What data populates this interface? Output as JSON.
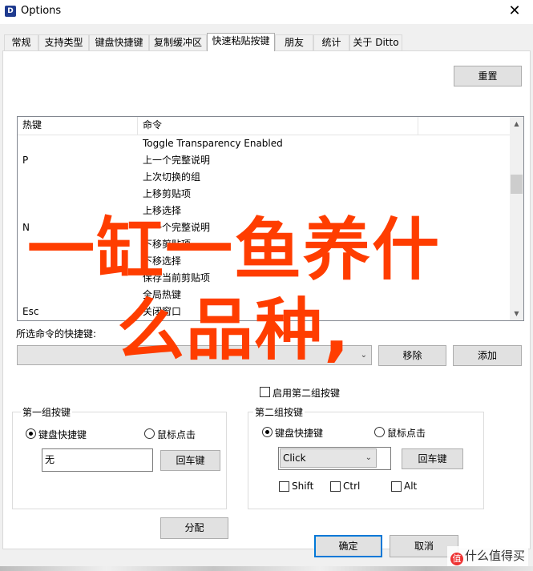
{
  "window": {
    "title": "Options",
    "app_icon": "ditto-icon",
    "close_glyph": "✕"
  },
  "tabs": [
    {
      "label": "常规"
    },
    {
      "label": "支持类型"
    },
    {
      "label": "键盘快捷键"
    },
    {
      "label": "复制缓冲区"
    },
    {
      "label": "快速粘贴按键",
      "active": true
    },
    {
      "label": "朋友"
    },
    {
      "label": "统计"
    },
    {
      "label": "关于 Ditto"
    }
  ],
  "panel": {
    "reset_label": "重置",
    "list": {
      "headers": {
        "hotkey": "热键",
        "command": "命令"
      },
      "rows": [
        {
          "hotkey": "",
          "command": "Toggle Transparency Enabled"
        },
        {
          "hotkey": "P",
          "command": "上一个完整说明"
        },
        {
          "hotkey": "",
          "command": "上次切换的组"
        },
        {
          "hotkey": "",
          "command": "上移剪贴项"
        },
        {
          "hotkey": "",
          "command": "上移选择"
        },
        {
          "hotkey": "N",
          "command": "下一个完整说明"
        },
        {
          "hotkey": "",
          "command": "下移剪贴项"
        },
        {
          "hotkey": "",
          "command": "下移选择"
        },
        {
          "hotkey": "",
          "command": "保存当前剪贴项"
        },
        {
          "hotkey": "",
          "command": "全局热键"
        },
        {
          "hotkey": "Esc",
          "command": "关闭窗口"
        }
      ]
    },
    "shortcut_label": "所选命令的快捷键:",
    "shortcut_combo_value": "",
    "remove_label": "移除",
    "add_label": "添加",
    "enable_second_group_label": "启用第二组按键",
    "group1": {
      "title": "第一组按键",
      "keyboard_label": "键盘快捷键",
      "mouse_label": "鼠标点击",
      "key_value": "无",
      "enter_label": "回车键"
    },
    "group2": {
      "title": "第二组按键",
      "keyboard_label": "键盘快捷键",
      "mouse_label": "鼠标点击",
      "mouse_combo_value": "Click",
      "enter_label": "回车键",
      "shift_label": "Shift",
      "ctrl_label": "Ctrl",
      "alt_label": "Alt"
    },
    "assign_label": "分配"
  },
  "footer": {
    "ok_label": "确定",
    "cancel_label": "取消"
  },
  "overlay": {
    "line1": "一缸一鱼养什",
    "line2": "么品种,",
    "color": "#ff3d00"
  },
  "watermark": {
    "badge": "值",
    "text": "什么值得买"
  }
}
